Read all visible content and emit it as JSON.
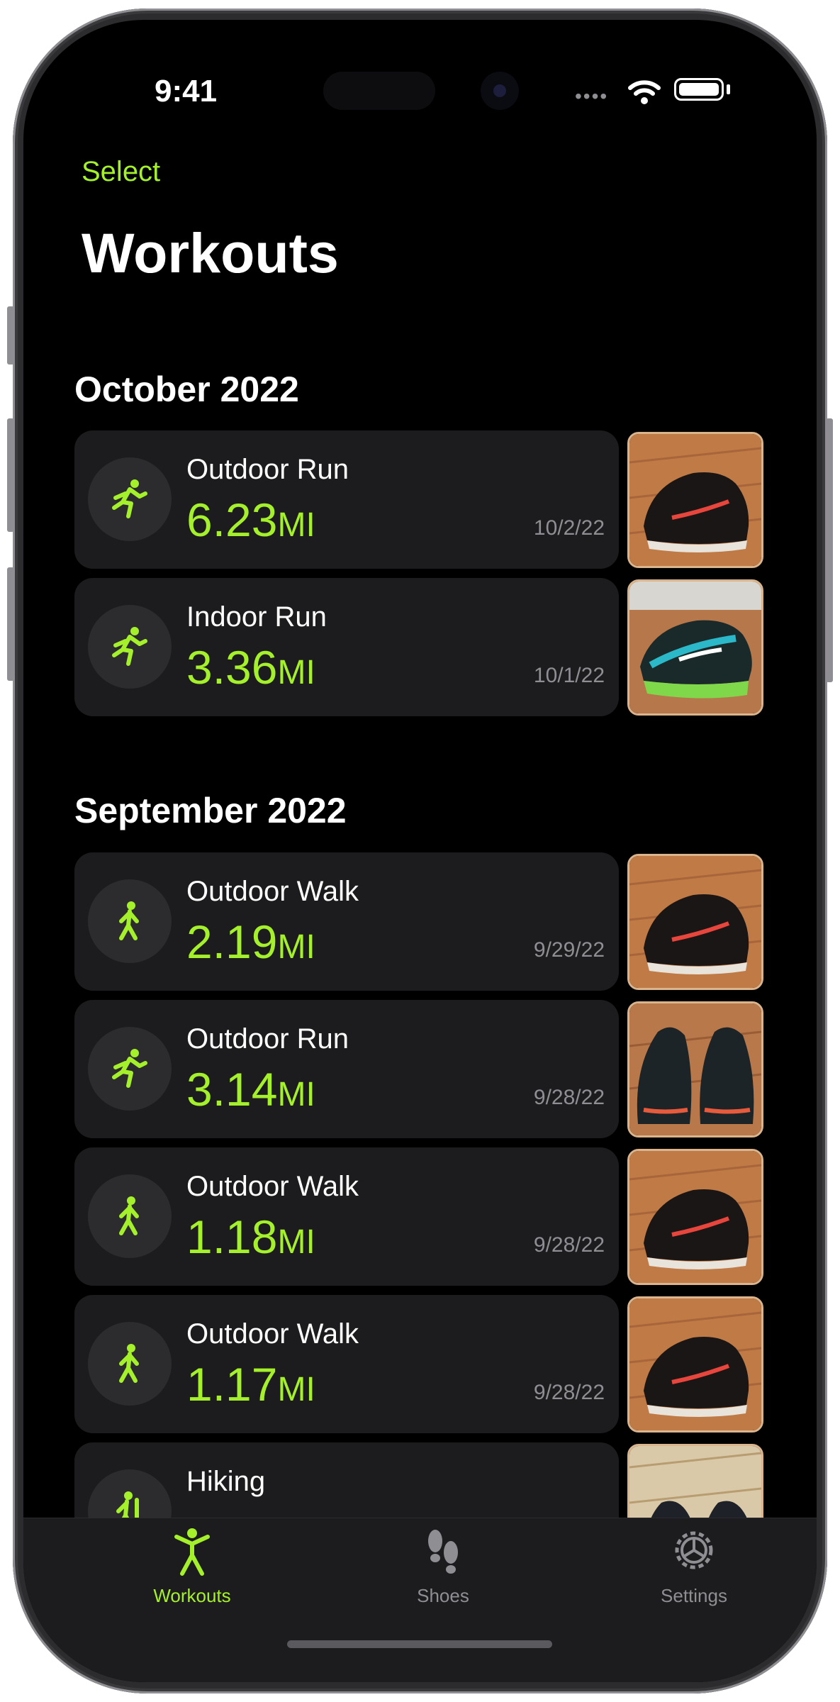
{
  "status": {
    "time": "9:41"
  },
  "nav": {
    "select_label": "Select",
    "title": "Workouts"
  },
  "sections": [
    {
      "title": "October 2022",
      "items": [
        {
          "type": "Outdoor Run",
          "distance": "6.23",
          "unit": "MI",
          "date": "10/2/22",
          "icon": "running-icon",
          "shoe": "black-red-shoe"
        },
        {
          "type": "Indoor Run",
          "distance": "3.36",
          "unit": "MI",
          "date": "10/1/22",
          "icon": "running-icon",
          "shoe": "black-green-shoe"
        }
      ]
    },
    {
      "title": "September 2022",
      "items": [
        {
          "type": "Outdoor Walk",
          "distance": "2.19",
          "unit": "MI",
          "date": "9/29/22",
          "icon": "walking-icon",
          "shoe": "black-red-shoe"
        },
        {
          "type": "Outdoor Run",
          "distance": "3.14",
          "unit": "MI",
          "date": "9/28/22",
          "icon": "running-icon",
          "shoe": "black-teal-shoe"
        },
        {
          "type": "Outdoor Walk",
          "distance": "1.18",
          "unit": "MI",
          "date": "9/28/22",
          "icon": "walking-icon",
          "shoe": "black-red-shoe"
        },
        {
          "type": "Outdoor Walk",
          "distance": "1.17",
          "unit": "MI",
          "date": "9/28/22",
          "icon": "walking-icon",
          "shoe": "black-red-shoe"
        },
        {
          "type": "Hiking",
          "distance": "",
          "unit": "",
          "date": "",
          "icon": "hiking-icon",
          "shoe": "black-boot"
        }
      ]
    }
  ],
  "tabs": [
    {
      "label": "Workouts",
      "icon": "figure-icon",
      "active": true
    },
    {
      "label": "Shoes",
      "icon": "footprints-icon",
      "active": false
    },
    {
      "label": "Settings",
      "icon": "gear-icon",
      "active": false
    }
  ],
  "colors": {
    "accent": "#a4f02b",
    "background": "#000000",
    "card": "#1c1c1e",
    "secondary_text": "#8e8e93"
  }
}
